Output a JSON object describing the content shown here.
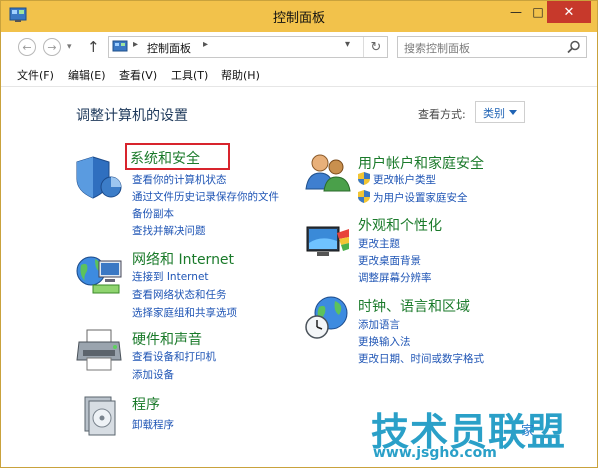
{
  "window": {
    "title": "控制面板",
    "min": "—",
    "max": "□",
    "close": "✕"
  },
  "nav": {
    "back": "←",
    "forward": "→",
    "recent": "▾",
    "up": "↑",
    "address": {
      "sep": "▸",
      "location": "控制面板",
      "refresh": "↻",
      "dropdown": "▾"
    },
    "search": {
      "placeholder": "搜索控制面板"
    }
  },
  "menu": [
    "文件(F)",
    "编辑(E)",
    "查看(V)",
    "工具(T)",
    "帮助(H)"
  ],
  "content": {
    "heading": "调整计算机的设置",
    "view_by_label": "查看方式:",
    "view_by_value": "类别",
    "categories": [
      {
        "title": "系统和安全",
        "icon": "shield-icon",
        "links": [
          "查看你的计算机状态",
          "通过文件历史记录保存你的文件",
          "备份副本",
          "查找并解决问题"
        ]
      },
      {
        "title": "网络和 Internet",
        "icon": "network-globe-icon",
        "links": [
          "连接到 Internet",
          "查看网络状态和任务",
          "选择家庭组和共享选项"
        ]
      },
      {
        "title": "硬件和声音",
        "icon": "printer-icon",
        "links": [
          "查看设备和打印机",
          "添加设备"
        ]
      },
      {
        "title": "程序",
        "icon": "programs-icon",
        "links": [
          "卸载程序"
        ]
      },
      {
        "title": "用户帐户和家庭安全",
        "icon": "users-icon",
        "links": [
          "更改帐户类型",
          "为用户设置家庭安全"
        ]
      },
      {
        "title": "外观和个性化",
        "icon": "display-icon",
        "links": [
          "更改主题",
          "更改桌面背景",
          "调整屏幕分辨率"
        ]
      },
      {
        "title": "时钟、语言和区域",
        "icon": "clock-globe-icon",
        "links": [
          "添加语言",
          "更换输入法",
          "更改日期、时间或数字格式"
        ]
      }
    ]
  },
  "watermark": {
    "brand": "技术员联盟",
    "tail": "家",
    "url": "www.jsgho.com"
  },
  "colors": {
    "titlebar": "#f2c24b",
    "close": "#c7392b",
    "category_title": "#1a7a2a",
    "link": "#1f55b5",
    "highlight": "#d8242d"
  }
}
